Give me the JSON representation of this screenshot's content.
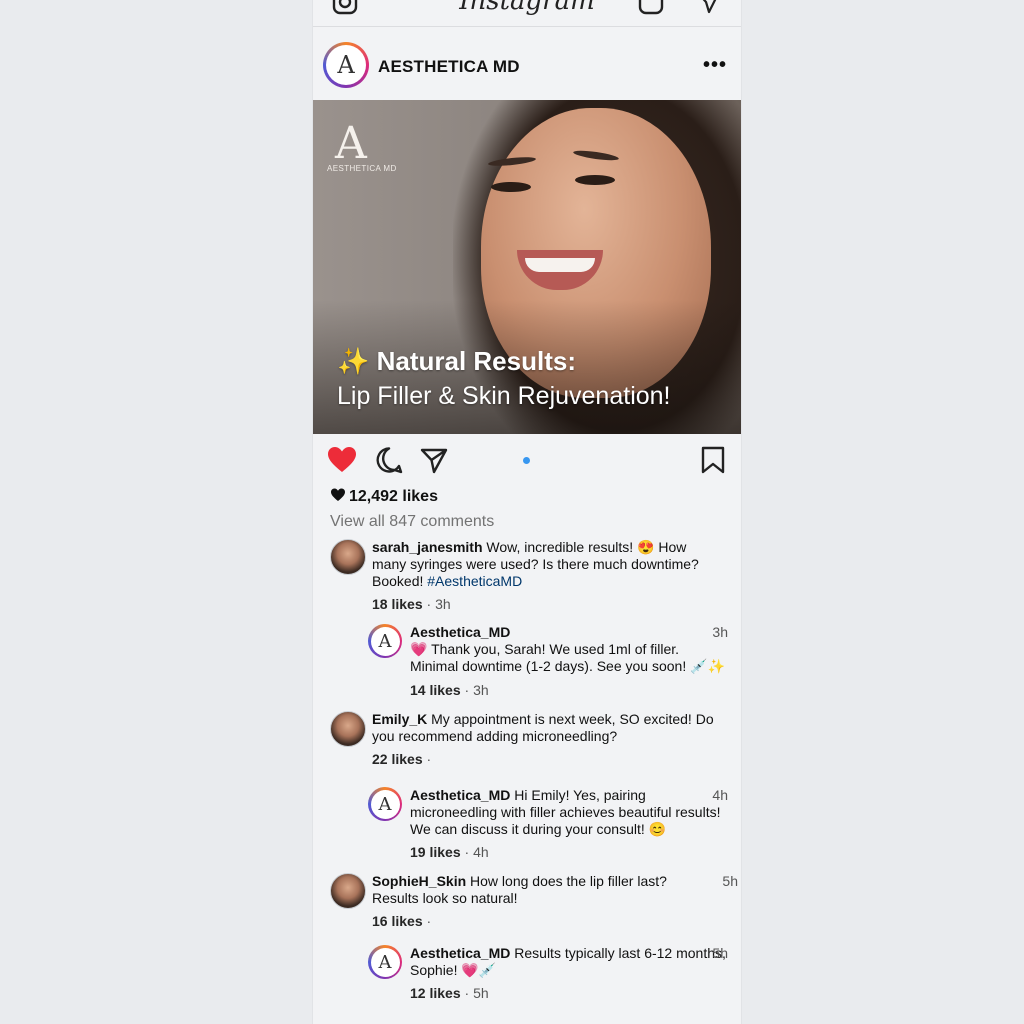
{
  "app": {
    "brand": "Instagram"
  },
  "post": {
    "account": "AESTHETICA MD",
    "avatar_letter": "A",
    "more": "•••",
    "image": {
      "logo_mark": "A",
      "logo_text": "AESTHETICA MD",
      "headline": "✨ Natural Results:",
      "subline": "Lip Filler & Skin Rejuvenation!"
    },
    "likes": "12,492 likes",
    "view_all_comments": "View all 847 comments"
  },
  "comments": [
    {
      "user": "sarah_janesmith",
      "text": "Wow, incredible results! 😍 How many syringes were used? Is there much downtime? Booked!",
      "tag": "#AestheticaMD",
      "likes": "18 likes",
      "time": "3h",
      "reply": {
        "user": "Aesthetica_MD",
        "text": "💗 Thank you, Sarah! We used 1ml of filler. Minimal downtime (1-2 days). See you soon! 💉✨",
        "time": "3h",
        "likes": "14 likes",
        "meta_time": "3h"
      }
    },
    {
      "user": "Emily_K",
      "text": "My appointment is next week, SO excited! Do you recommend adding microneedling?",
      "likes": "22 likes",
      "time": "",
      "reply": {
        "user": "Aesthetica_MD",
        "text": "Hi Emily! Yes, pairing microneedling with filler achieves beautiful results! We can discuss it during your consult! 😊",
        "time": "4h",
        "likes": "19 likes",
        "meta_time": "4h"
      }
    },
    {
      "user": "SophieH_Skin",
      "text": "How long does the lip filler last? Results look so natural!",
      "likes": "16 likes",
      "time": "5h",
      "reply": {
        "user": "Aesthetica_MD",
        "text": "Results typically last 6-12 months, Sophie! 💗💉",
        "time": "5h",
        "likes": "12 likes",
        "meta_time": "5h"
      }
    }
  ],
  "icons": [
    "camera-icon",
    "igtv-icon",
    "direct-icon",
    "more-icon",
    "heart-icon",
    "comment-icon",
    "share-icon",
    "bookmark-icon"
  ],
  "colors": {
    "heart": "#ed2c39",
    "tag": "#00376b",
    "muted": "#737373"
  }
}
